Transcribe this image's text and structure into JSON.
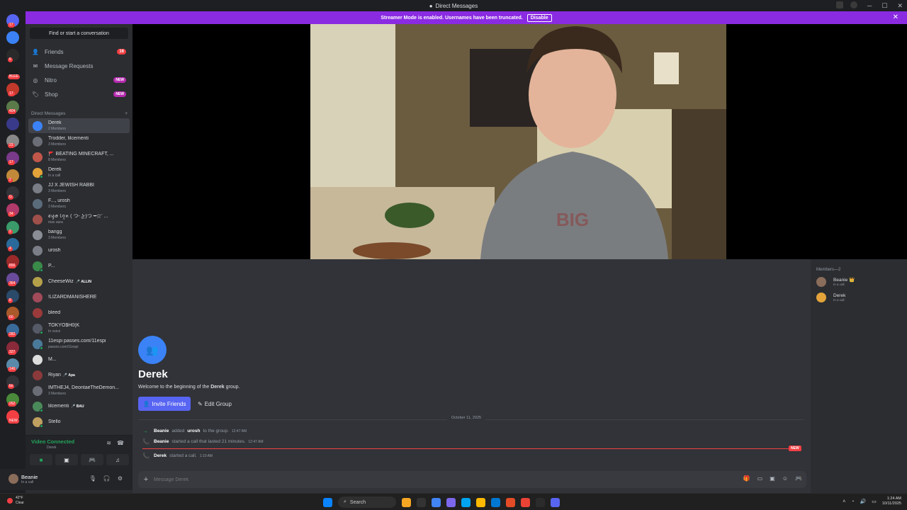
{
  "window": {
    "title": "Direct Messages",
    "controls": [
      "─",
      "☐",
      "✕"
    ]
  },
  "banner": {
    "text": "Streamer Mode is enabled. Usernames have been truncated.",
    "button": "Disable"
  },
  "sidebar": {
    "find_placeholder": "Find or start a conversation",
    "nav": [
      {
        "label": "Friends",
        "icon": "friends-icon",
        "badge": "16"
      },
      {
        "label": "Message Requests",
        "icon": "envelope-icon",
        "badge": ""
      },
      {
        "label": "Nitro",
        "icon": "nitro-icon",
        "badge": "NEW"
      },
      {
        "label": "Shop",
        "icon": "shop-icon",
        "badge": "NEW"
      }
    ],
    "dm_header": "Direct Messages",
    "dm_add": "+",
    "dms": [
      {
        "name": "Derek",
        "sub": "2 Members",
        "tag": "",
        "color": "#3b82f6",
        "selected": true
      },
      {
        "name": "Trodder, lilcementi",
        "sub": "3 Members",
        "tag": "",
        "color": "#6b6e76"
      },
      {
        "name": "🚩 BEATING MINECRAFT, ...",
        "sub": "8 Members",
        "tag": "",
        "color": "#c0574a"
      },
      {
        "name": "Derek",
        "sub": "In a call",
        "tag": "",
        "color": "#e3a33a",
        "online": true
      },
      {
        "name": "JJ X JEWISH RABBI",
        "sub": "3 Members",
        "tag": "",
        "color": "#7a7d85"
      },
      {
        "name": "F..., urosh",
        "sub": "3 Members",
        "tag": "",
        "color": "#5a6b7a"
      },
      {
        "name": "ꫀꪗꪮ ꪶꪖꪀ ( つ- ͜ʖ-)つ ━☆ﾟ...",
        "sub": "max aura",
        "tag": "",
        "color": "#a0504a"
      },
      {
        "name": "bangg",
        "sub": "3 Members",
        "tag": "",
        "color": "#8a8d95"
      },
      {
        "name": "urosh",
        "sub": "",
        "tag": "",
        "color": "#7b7e86"
      },
      {
        "name": "P...",
        "sub": "",
        "tag": "",
        "color": "#3a8a4a",
        "online": true
      },
      {
        "name": "CheeseWiz",
        "sub": "",
        "tag": "🎤 ALLIN",
        "color": "#b5a04a"
      },
      {
        "name": "!LIZARDMANISHERE",
        "sub": "",
        "tag": "",
        "color": "#a04a5a"
      },
      {
        "name": "bleed",
        "sub": "",
        "tag": "",
        "color": "#9a3a3a"
      },
      {
        "name": "TOKYO$H0(K",
        "sub": "In voice",
        "tag": "",
        "color": "#555a66",
        "online": true
      },
      {
        "name": "11espi passes.com/11espi",
        "sub": "passes.com/11espi",
        "tag": "",
        "color": "#4a7a9a",
        "online": true
      },
      {
        "name": "M...",
        "sub": "",
        "tag": "",
        "color": "#dddddd"
      },
      {
        "name": "Riyan",
        "sub": "",
        "tag": "🎤 Apa",
        "color": "#8a3a3a"
      },
      {
        "name": "IMTHEJ4, DeontaeTheDemon...",
        "sub": "3 Members",
        "tag": "",
        "color": "#6a6d75"
      },
      {
        "name": "lilcementi",
        "sub": "",
        "tag": "🎤 BAU",
        "color": "#4a8a5a",
        "online": true
      },
      {
        "name": "Stello",
        "sub": "",
        "tag": "",
        "color": "#c0a060",
        "online": true
      }
    ],
    "voice": {
      "status": "Video Connected",
      "sub": "Derek",
      "buttons": [
        "camera-icon",
        "screen-share-icon",
        "activity-icon",
        "soundboard-icon"
      ]
    },
    "user": {
      "name": "Beanie",
      "status": "In a call"
    }
  },
  "servers": [
    {
      "color": "#5865f2",
      "badge": "17"
    },
    {
      "color": "#3b82f6",
      "badge": ""
    },
    {
      "color": "#2a2a2a",
      "badge": "6"
    },
    {
      "color": "#1e1e1e",
      "badge": "BLEE"
    },
    {
      "color": "#c0392b",
      "badge": "17"
    },
    {
      "color": "#5a7a4a",
      "badge": "404"
    },
    {
      "color": "#3a3a8a",
      "badge": ""
    },
    {
      "color": "#888888",
      "badge": "23"
    },
    {
      "color": "#7a3a8a",
      "badge": "17"
    },
    {
      "color": "#c08a3a",
      "badge": "2"
    },
    {
      "color": "#313338",
      "badge": "G"
    },
    {
      "color": "#b03a6a",
      "badge": "34"
    },
    {
      "color": "#3a9a6a",
      "badge": "2"
    },
    {
      "color": "#2a6a9a",
      "badge": "4"
    },
    {
      "color": "#9a2a2a",
      "badge": "856"
    },
    {
      "color": "#6a4a9a",
      "badge": "364"
    },
    {
      "color": "#2a4a6a",
      "badge": "8"
    },
    {
      "color": "#aa5a2a",
      "badge": "60"
    },
    {
      "color": "#3a6a9a",
      "badge": "282"
    },
    {
      "color": "#8a2a3a",
      "badge": "327"
    },
    {
      "color": "#5a8aaa",
      "badge": "146"
    },
    {
      "color": "#313338",
      "badge": "bs"
    },
    {
      "color": "#4a8a3a",
      "badge": "262"
    },
    {
      "color": "#f23f43",
      "badge": "NEW"
    }
  ],
  "chat": {
    "group_title": "Derek",
    "welcome_prefix": "Welcome to the beginning of the ",
    "welcome_bold": "Derek",
    "welcome_suffix": " group.",
    "invite_label": "Invite Friends",
    "edit_label": "Edit Group",
    "date_divider": "October 11, 2025",
    "messages": [
      {
        "icon": "arrow-right-icon",
        "actor": "Beanie",
        "mid": " added ",
        "target": "urosh",
        "rest": " to the group.",
        "time": "12:47 AM"
      },
      {
        "icon": "phone-icon",
        "actor": "Beanie",
        "mid": " started a call that lasted 21 minutes.",
        "target": "",
        "rest": "",
        "time": "12:47 AM"
      },
      {
        "icon": "phone-icon",
        "actor": "Derek",
        "mid": " started a call.",
        "target": "",
        "rest": "",
        "time": "1:10 AM"
      }
    ],
    "new_label": "NEW",
    "input_placeholder": "Message Derek"
  },
  "members": {
    "header": "Members—2",
    "list": [
      {
        "name": "Beanie 👑",
        "status": "In a call",
        "color": "#8a6d5a"
      },
      {
        "name": "Derek",
        "status": "In a call",
        "color": "#e3a33a"
      }
    ]
  },
  "taskbar": {
    "weather": "42°F",
    "weather_sub": "Clear",
    "search": "Search",
    "time": "1:24 AM",
    "date": "10/11/2025",
    "apps": [
      "#f5a623",
      "#333333",
      "#4285f4",
      "#7b68ee",
      "#00a4ef",
      "#ffb900",
      "#0078d4",
      "#e34c26",
      "#ea4335",
      "#2b2b2b",
      "#5865f2"
    ]
  }
}
